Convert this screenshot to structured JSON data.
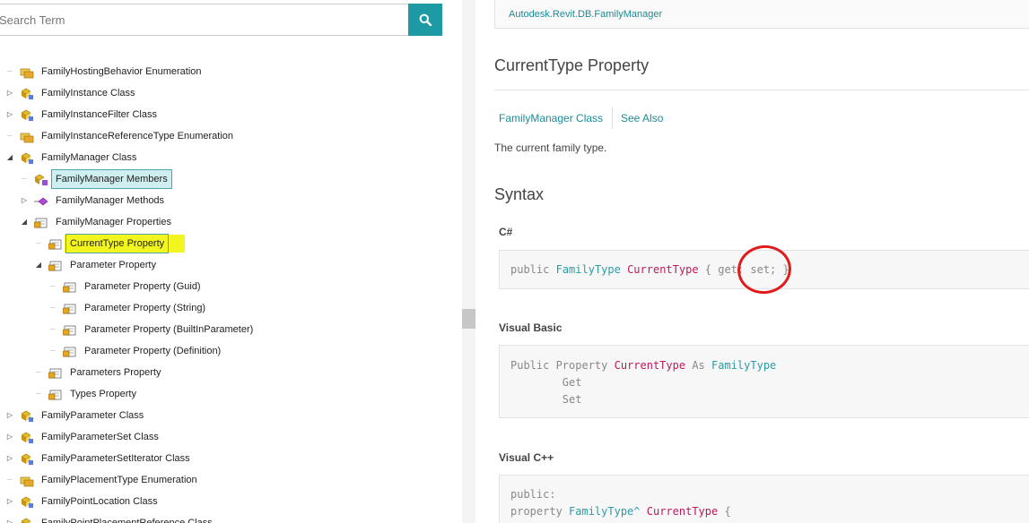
{
  "search": {
    "placeholder": "Search Term"
  },
  "tree": {
    "items": [
      {
        "label": "FamilyHostingBehavior Enumeration",
        "icon": "enum-icon",
        "expand": "",
        "indent": 0,
        "state": ""
      },
      {
        "label": "FamilyInstance Class",
        "icon": "class-icon",
        "expand": "collapsed",
        "indent": 0,
        "state": ""
      },
      {
        "label": "FamilyInstanceFilter Class",
        "icon": "class-icon",
        "expand": "collapsed",
        "indent": 0,
        "state": ""
      },
      {
        "label": "FamilyInstanceReferenceType Enumeration",
        "icon": "enum-icon",
        "expand": "",
        "indent": 0,
        "state": ""
      },
      {
        "label": "FamilyManager Class",
        "icon": "class-icon",
        "expand": "expanded",
        "indent": 0,
        "state": ""
      },
      {
        "label": "FamilyManager Members",
        "icon": "members-icon",
        "expand": "",
        "indent": 1,
        "state": "selected"
      },
      {
        "label": "FamilyManager Methods",
        "icon": "method-icon",
        "expand": "collapsed",
        "indent": 1,
        "state": ""
      },
      {
        "label": "FamilyManager Properties",
        "icon": "property-icon",
        "expand": "expanded",
        "indent": 1,
        "state": ""
      },
      {
        "label": "CurrentType Property",
        "icon": "property-icon",
        "expand": "",
        "indent": 2,
        "state": "highlighted"
      },
      {
        "label": "Parameter Property",
        "icon": "property-icon",
        "expand": "expanded",
        "indent": 2,
        "state": ""
      },
      {
        "label": "Parameter Property (Guid)",
        "icon": "property-icon",
        "expand": "",
        "indent": 3,
        "state": ""
      },
      {
        "label": "Parameter Property (String)",
        "icon": "property-icon",
        "expand": "",
        "indent": 3,
        "state": ""
      },
      {
        "label": "Parameter Property (BuiltInParameter)",
        "icon": "property-icon",
        "expand": "",
        "indent": 3,
        "state": ""
      },
      {
        "label": "Parameter Property (Definition)",
        "icon": "property-icon",
        "expand": "",
        "indent": 3,
        "state": ""
      },
      {
        "label": "Parameters Property",
        "icon": "property-icon",
        "expand": "",
        "indent": 2,
        "state": ""
      },
      {
        "label": "Types Property",
        "icon": "property-icon",
        "expand": "",
        "indent": 2,
        "state": ""
      },
      {
        "label": "FamilyParameter Class",
        "icon": "class-icon",
        "expand": "collapsed",
        "indent": 0,
        "state": ""
      },
      {
        "label": "FamilyParameterSet Class",
        "icon": "class-icon",
        "expand": "collapsed",
        "indent": 0,
        "state": ""
      },
      {
        "label": "FamilyParameterSetIterator Class",
        "icon": "class-icon",
        "expand": "collapsed",
        "indent": 0,
        "state": ""
      },
      {
        "label": "FamilyPlacementType Enumeration",
        "icon": "enum-icon",
        "expand": "",
        "indent": 0,
        "state": ""
      },
      {
        "label": "FamilyPointLocation Class",
        "icon": "class-icon",
        "expand": "collapsed",
        "indent": 0,
        "state": ""
      },
      {
        "label": "FamilyPointPlacementReference Class",
        "icon": "class-icon",
        "expand": "collapsed",
        "indent": 0,
        "state": ""
      }
    ]
  },
  "doc": {
    "namespace": "Autodesk.Revit.DB.FamilyManager",
    "title": "CurrentType Property",
    "links": {
      "class": "FamilyManager Class",
      "see_also": "See Also"
    },
    "summary": "The current family type.",
    "syntax_heading": "Syntax",
    "csharp": {
      "heading": "C#",
      "kw_public": "public",
      "type": "FamilyType",
      "member": "CurrentType",
      "accessors": "{ get; set; }"
    },
    "vb": {
      "heading": "Visual Basic",
      "kw_public_property": "Public Property",
      "member": "CurrentType",
      "kw_as": "As",
      "type": "FamilyType",
      "get": "Get",
      "set": "Set"
    },
    "cpp": {
      "heading": "Visual C++",
      "kw_public": "public:",
      "kw_property": "property",
      "type": "FamilyType^",
      "member": "CurrentType",
      "brace": "{"
    }
  },
  "colors": {
    "accent": "#1d9aa4",
    "link": "#1d8a96",
    "highlighter": "#f3f51e",
    "annotation": "#e01b1b",
    "type": "#2d9ba3",
    "member": "#c2185b"
  }
}
